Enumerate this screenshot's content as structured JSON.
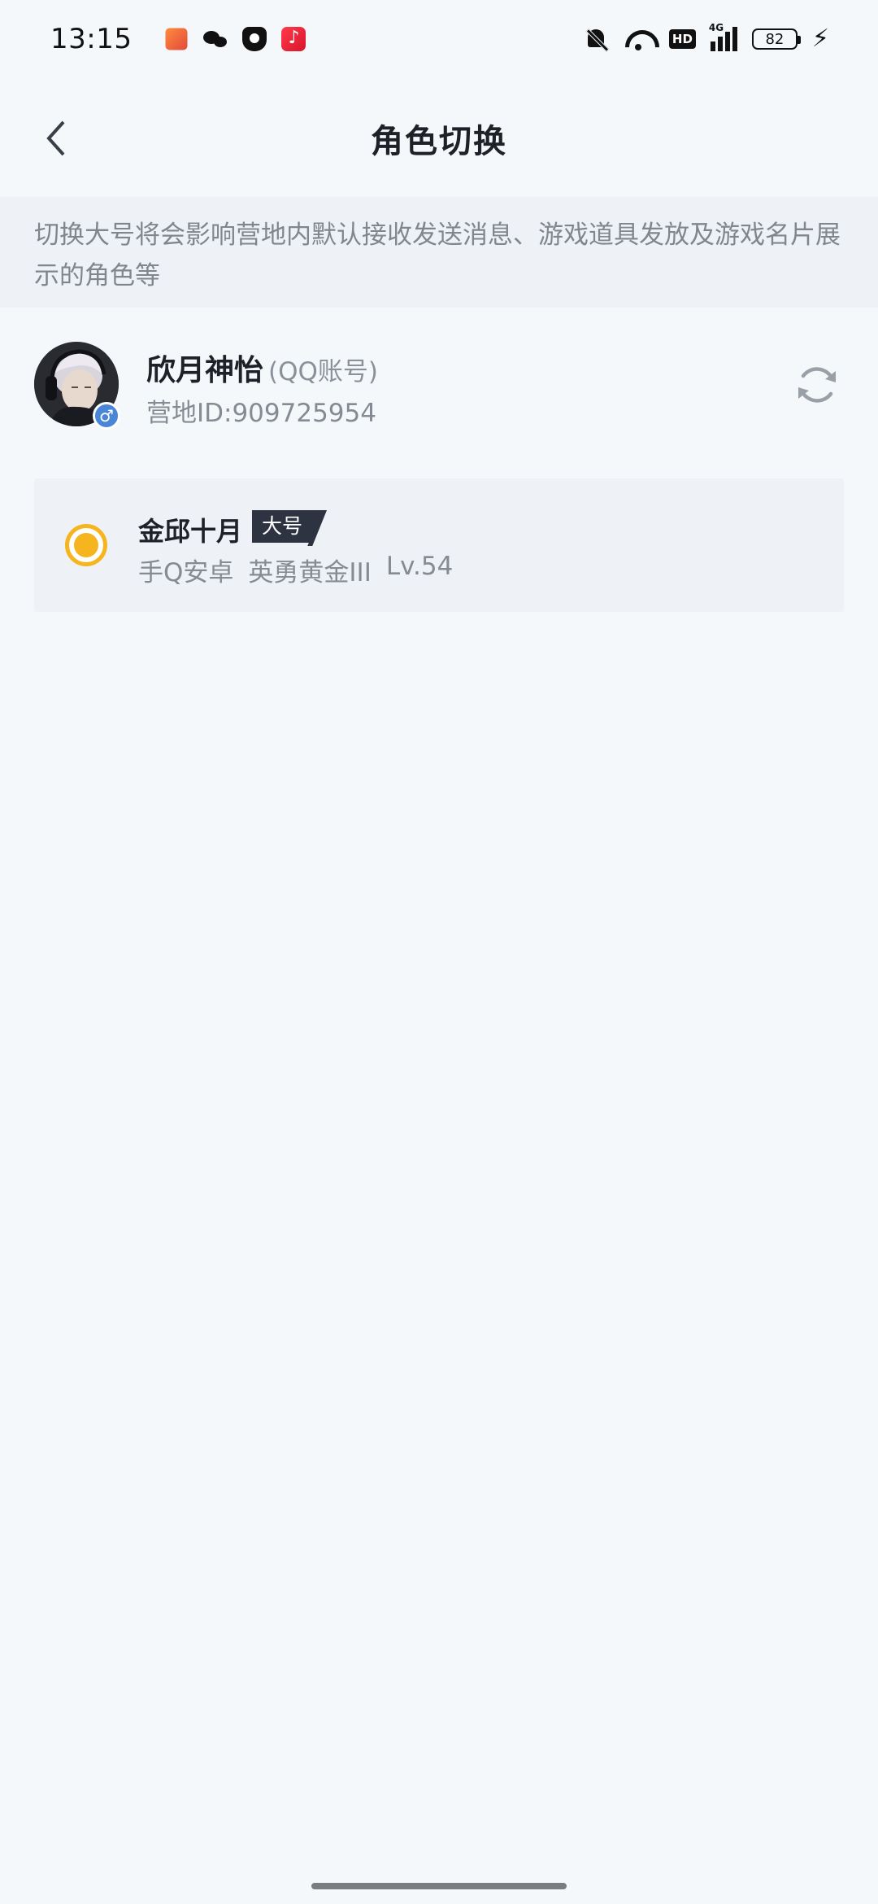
{
  "status_bar": {
    "time": "13:15",
    "left_icons": [
      "game-app-icon",
      "wechat-icon",
      "shield-app-icon",
      "music-app-icon"
    ],
    "right_icons": [
      "bell-off-icon",
      "wifi-icon",
      "hd-icon",
      "signal-icon",
      "battery-icon",
      "charging-icon"
    ],
    "hd_label": "HD",
    "network_label": "4G",
    "battery_level": "82"
  },
  "nav": {
    "title": "角色切换"
  },
  "notice": {
    "text": "切换大号将会影响营地内默认接收发送消息、游戏道具发放及游戏名片展示的角色等"
  },
  "account": {
    "name": "欣月神怡",
    "type": "(QQ账号)",
    "id_text": "营地ID:909725954",
    "gender_symbol": "♂"
  },
  "roles": [
    {
      "name": "金邱十月",
      "badge": "大号",
      "platform": "手Q安卓",
      "rank": "英勇黄金III",
      "level": "Lv.54",
      "selected": true
    }
  ],
  "colors": {
    "background": "#f5f8fb",
    "notice_bg": "#eef1f5",
    "radio_accent": "#f6b51e",
    "badge_bg": "#2d3340",
    "gender_badge": "#4a86d8",
    "secondary_text": "#858b93"
  }
}
